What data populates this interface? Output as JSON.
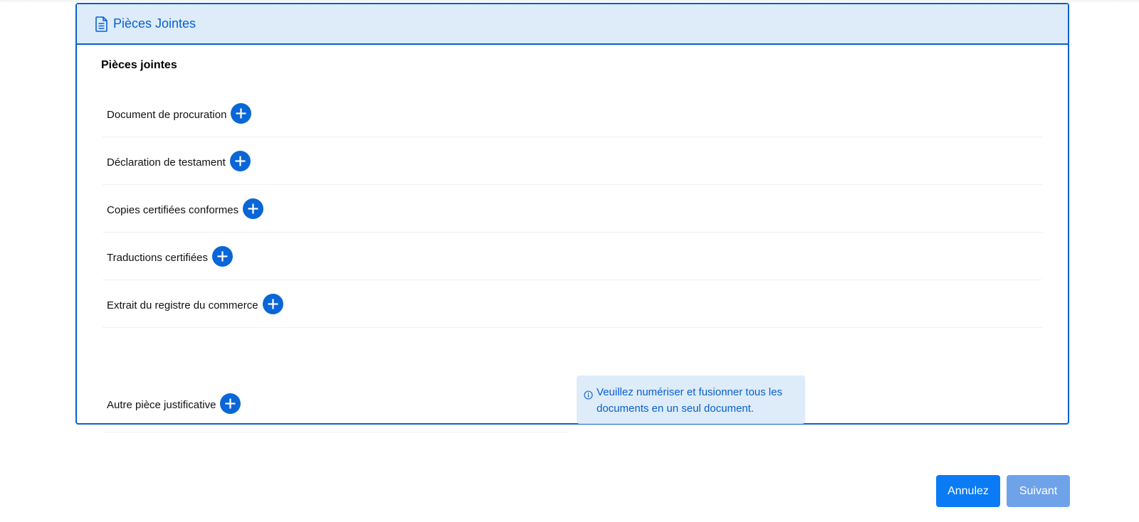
{
  "panel": {
    "title": "Pièces Jointes",
    "header_icon": "document-icon",
    "section_title": "Pièces jointes"
  },
  "attachments": [
    {
      "label": "Document de procuration",
      "action_icon": "plus-circle-icon"
    },
    {
      "label": "Déclaration de testament",
      "action_icon": "plus-circle-icon"
    },
    {
      "label": "Copies certifiées conformes",
      "action_icon": "plus-circle-icon"
    },
    {
      "label": "Traductions certifiées",
      "action_icon": "plus-circle-icon"
    },
    {
      "label": "Extrait du registre du commerce",
      "action_icon": "plus-circle-icon"
    },
    {
      "label": "Autre pièce justificative",
      "action_icon": "plus-circle-icon"
    }
  ],
  "info": {
    "icon": "info-icon",
    "line1": "Veuillez numériser et fusionner tous les",
    "line2": "documents en un seul document."
  },
  "footer": {
    "cancel_label": "Annulez",
    "next_label": "Suivant"
  },
  "colors": {
    "primary": "#0a5fd0",
    "header_bg": "#ddecf8",
    "cancel_button": "#0a7bf5",
    "next_button_disabled": "#6ea3ea"
  }
}
